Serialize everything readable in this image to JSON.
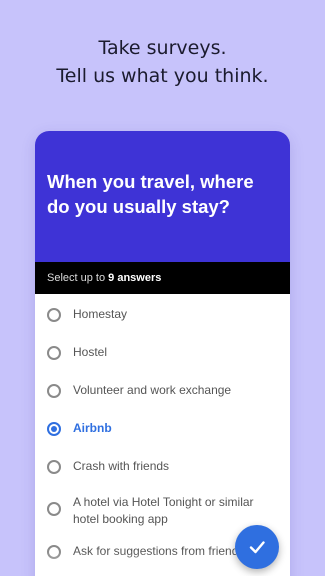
{
  "headline": {
    "line1": "Take surveys.",
    "line2": "Tell us what you think."
  },
  "survey": {
    "question": "When you travel, where do you usually stay?",
    "hint_prefix": "Select up to ",
    "hint_count": "9 answers",
    "options": [
      {
        "label": "Homestay",
        "selected": false
      },
      {
        "label": "Hostel",
        "selected": false
      },
      {
        "label": "Volunteer and work exchange",
        "selected": false
      },
      {
        "label": "Airbnb",
        "selected": true
      },
      {
        "label": "Crash with friends",
        "selected": false
      },
      {
        "label": "A hotel via Hotel Tonight or similar hotel booking app",
        "selected": false
      },
      {
        "label": "Ask for suggestions from friends",
        "selected": false
      }
    ]
  },
  "submit_button": {
    "icon": "check-icon"
  },
  "colors": {
    "background": "#c7c3fb",
    "header": "#3e33d6",
    "accent": "#2f6fe0"
  }
}
